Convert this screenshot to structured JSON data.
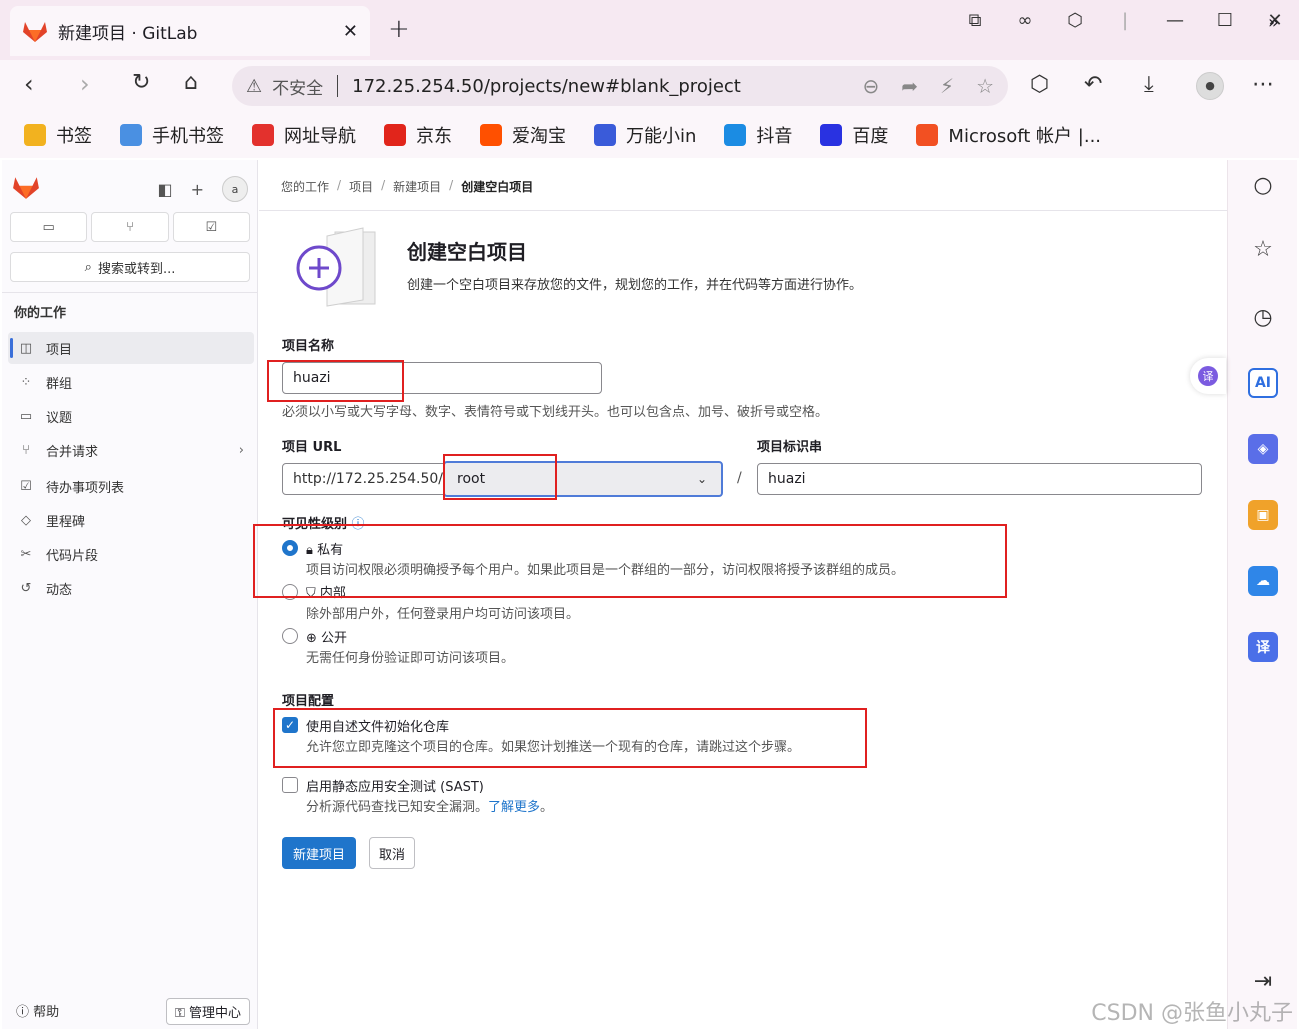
{
  "browser": {
    "tab_title": "新建项目 · GitLab",
    "new_tab": "+",
    "insecure_label": "不安全",
    "url": "172.25.254.50/projects/new#blank_project",
    "bookmarks": [
      {
        "label": "书签",
        "icon": "star-icon",
        "color": "#f2b21f"
      },
      {
        "label": "手机书签",
        "icon": "phone-icon",
        "color": "#4a90e2"
      },
      {
        "label": "网址导航",
        "icon": "hao-icon",
        "color": "#e3312d"
      },
      {
        "label": "京东",
        "icon": "jd-icon",
        "color": "#e1251b"
      },
      {
        "label": "爱淘宝",
        "icon": "taobao-icon",
        "color": "#ff5000"
      },
      {
        "label": "万能小in",
        "icon": "robot-icon",
        "color": "#3a5bd9"
      },
      {
        "label": "抖音",
        "icon": "edge-icon",
        "color": "#1b8ce3"
      },
      {
        "label": "百度",
        "icon": "baidu-icon",
        "color": "#2932e1"
      },
      {
        "label": "Microsoft 帐户 |...",
        "icon": "microsoft-icon",
        "color": "#f25022"
      }
    ],
    "bookmarks_more": "»"
  },
  "sidebar": {
    "avatar_alt": "a",
    "search_label": "搜索或转到...",
    "section_title": "你的工作",
    "items": [
      {
        "label": "项目",
        "icon": "project-icon",
        "glyph": "◫"
      },
      {
        "label": "群组",
        "icon": "group-icon",
        "glyph": "⁘"
      },
      {
        "label": "议题",
        "icon": "issue-icon",
        "glyph": "▭"
      },
      {
        "label": "合并请求",
        "icon": "merge-request-icon",
        "glyph": "⑂"
      },
      {
        "label": "待办事项列表",
        "icon": "todo-icon",
        "glyph": "☑"
      },
      {
        "label": "里程碑",
        "icon": "milestone-icon",
        "glyph": "◇"
      },
      {
        "label": "代码片段",
        "icon": "snippet-icon",
        "glyph": "✂"
      },
      {
        "label": "动态",
        "icon": "activity-icon",
        "glyph": "↺"
      }
    ],
    "help_label": "帮助",
    "admin_label": "管理中心"
  },
  "main": {
    "breadcrumb": [
      "您的工作",
      "项目",
      "新建项目",
      "创建空白项目"
    ],
    "title": "创建空白项目",
    "description": "创建一个空白项目来存放您的文件，规划您的工作，并在代码等方面进行协作。",
    "name_label": "项目名称",
    "name_value": "huazi",
    "name_help": "必须以小写或大写字母、数字、表情符号或下划线开头。也可以包含点、加号、破折号或空格。",
    "url_label": "项目 URL",
    "url_prefix": "http://172.25.254.50/",
    "namespace_value": "root",
    "slug_label": "项目标识串",
    "slug_value": "huazi",
    "visibility_label": "可见性级别",
    "visibility": [
      {
        "label": "私有",
        "desc": "项目访问权限必须明确授予每个用户。如果此项目是一个群组的一部分，访问权限将授予该群组的成员。",
        "checked": true
      },
      {
        "label": "内部",
        "desc": "除外部用户外，任何登录用户均可访问该项目。",
        "checked": false
      },
      {
        "label": "公开",
        "desc": "无需任何身份验证即可访问该项目。",
        "checked": false
      }
    ],
    "config_label": "项目配置",
    "readme_label": "使用自述文件初始化仓库",
    "readme_desc": "允许您立即克隆这个项目的仓库。如果您计划推送一个现有的仓库，请跳过这个步骤。",
    "readme_checked": true,
    "sast_label": "启用静态应用安全测试 (SAST)",
    "sast_desc": "分析源代码查找已知安全漏洞。",
    "sast_link": "了解更多",
    "sast_desc_end": "。",
    "sast_checked": false,
    "create_button": "新建项目",
    "cancel_button": "取消"
  },
  "right_panel": {
    "translate_badge": "译",
    "ai_label": "AI",
    "translate_label": "译"
  },
  "watermark": "CSDN @张鱼小丸子",
  "colors": {
    "primary": "#1f75cb",
    "annotation": "#e02020",
    "chrome": "#f6e9f2"
  }
}
